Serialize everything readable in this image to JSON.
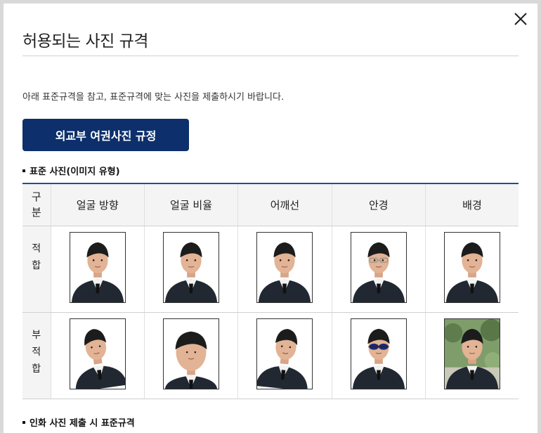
{
  "dialog": {
    "title": "허용되는 사진 규격",
    "description": "아래 표준규격을 참고, 표준규격에 맞는 사진을 제출하시기 바랍니다.",
    "primary_button": "외교부 여권사진 규정",
    "close_icon": "close-icon"
  },
  "section_standard": {
    "heading": "표준 사진(이미지 유형)"
  },
  "section_print": {
    "heading": "인화 사진 제출 시 표준규격"
  },
  "table": {
    "corner": "구분",
    "columns": [
      "얼굴 방향",
      "얼굴 비율",
      "어깨선",
      "안경",
      "배경"
    ],
    "rows": [
      {
        "label": "적합",
        "photos": [
          "photo-front",
          "photo-ratio",
          "photo-shoulder",
          "photo-glasses",
          "photo-background"
        ]
      },
      {
        "label": "부적합",
        "photos": [
          "photo-turned",
          "photo-too-large",
          "photo-tilted-shoulder",
          "photo-sunglasses",
          "photo-outdoor-background"
        ]
      }
    ]
  },
  "colors": {
    "button_bg": "#0d2f6b",
    "table_top_border": "#1f4f95",
    "header_bg": "#f4f4f4"
  }
}
